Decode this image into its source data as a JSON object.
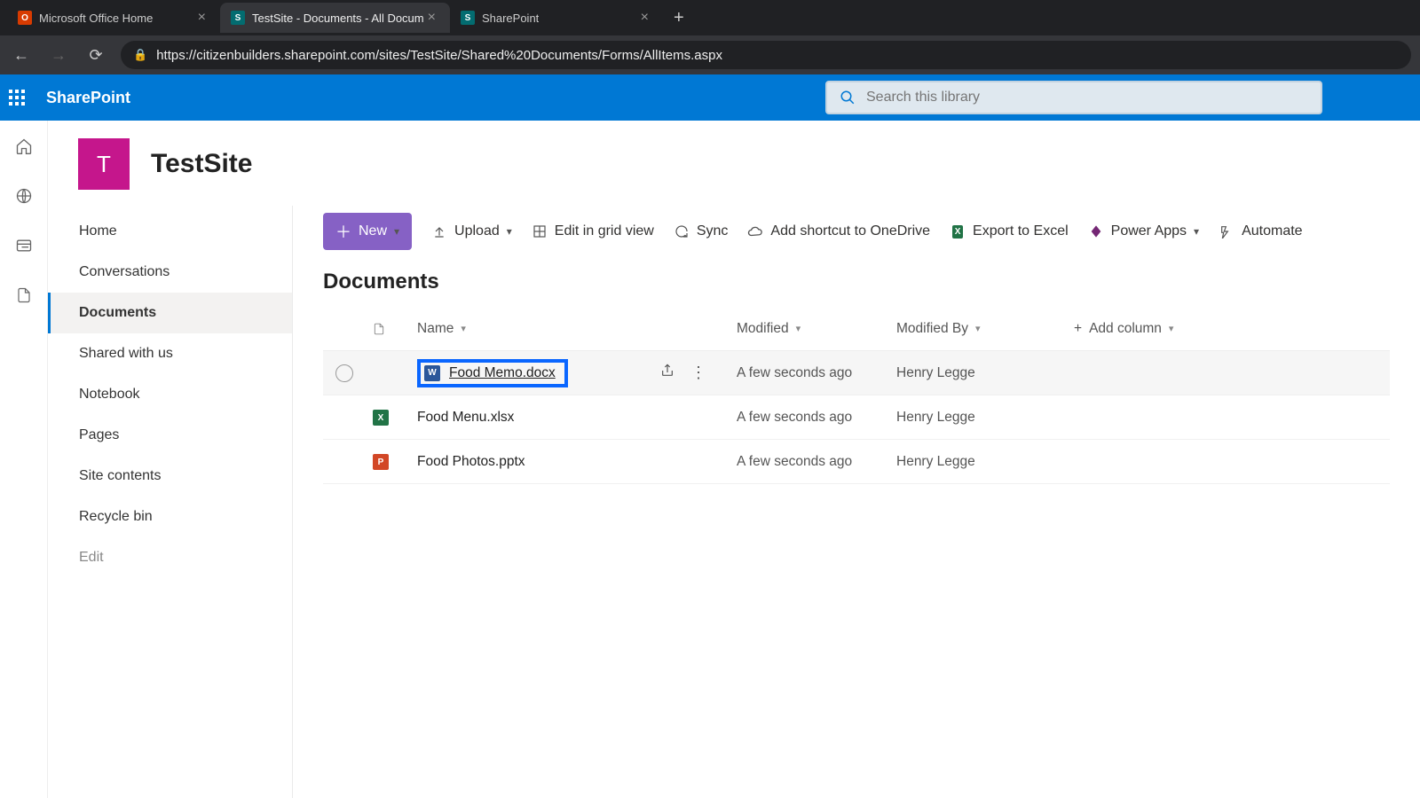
{
  "browser": {
    "tabs": [
      {
        "label": "Microsoft Office Home",
        "icon_bg": "#d83b01",
        "icon_text": "O",
        "active": false
      },
      {
        "label": "TestSite - Documents - All Docum",
        "icon_bg": "#036c70",
        "icon_text": "S",
        "active": true
      },
      {
        "label": "SharePoint",
        "icon_bg": "#036c70",
        "icon_text": "S",
        "active": false
      }
    ],
    "url": "https://citizenbuilders.sharepoint.com/sites/TestSite/Shared%20Documents/Forms/AllItems.aspx"
  },
  "suite": {
    "brand": "SharePoint",
    "search_placeholder": "Search this library"
  },
  "site": {
    "logo_letter": "T",
    "title": "TestSite"
  },
  "nav": {
    "items": [
      "Home",
      "Conversations",
      "Documents",
      "Shared with us",
      "Notebook",
      "Pages",
      "Site contents",
      "Recycle bin",
      "Edit"
    ],
    "active_index": 2,
    "muted_index": 8
  },
  "commands": {
    "new": "New",
    "upload": "Upload",
    "grid": "Edit in grid view",
    "sync": "Sync",
    "shortcut": "Add shortcut to OneDrive",
    "export": "Export to Excel",
    "powerapps": "Power Apps",
    "automate": "Automate"
  },
  "library": {
    "title": "Documents",
    "columns": {
      "name": "Name",
      "modified": "Modified",
      "modifiedby": "Modified By",
      "addcol": "Add column"
    },
    "rows": [
      {
        "type": "word",
        "name": "Food Memo.docx",
        "modified": "A few seconds ago",
        "by": "Henry Legge",
        "hovered": true,
        "highlighted": true
      },
      {
        "type": "excel",
        "name": "Food Menu.xlsx",
        "modified": "A few seconds ago",
        "by": "Henry Legge",
        "hovered": false,
        "highlighted": false
      },
      {
        "type": "ppt",
        "name": "Food Photos.pptx",
        "modified": "A few seconds ago",
        "by": "Henry Legge",
        "hovered": false,
        "highlighted": false
      }
    ]
  }
}
